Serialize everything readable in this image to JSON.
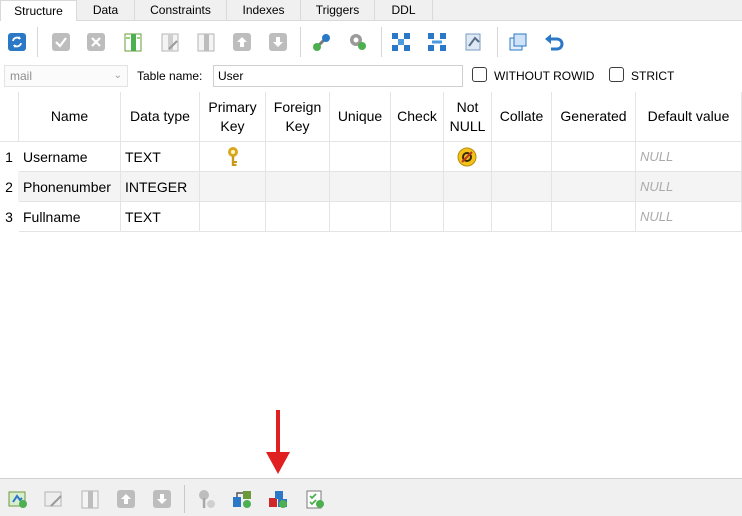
{
  "tabs": [
    {
      "label": "Structure",
      "active": true
    },
    {
      "label": "Data",
      "active": false
    },
    {
      "label": "Constraints",
      "active": false
    },
    {
      "label": "Indexes",
      "active": false
    },
    {
      "label": "Triggers",
      "active": false
    },
    {
      "label": "DDL",
      "active": false
    }
  ],
  "toolbar": {
    "icons": [
      "refresh-icon",
      "commit-icon",
      "rollback-icon",
      "add-column-icon",
      "edit-column-icon",
      "delete-column-icon",
      "move-up-icon",
      "move-down-icon",
      "add-primary-key-icon",
      "add-foreign-key-icon",
      "add-unique-icon",
      "add-check-icon",
      "add-not-null-icon",
      "add-collation-icon",
      "create-similar-table-icon",
      "reset-icon"
    ]
  },
  "table_name_row": {
    "database": "mail",
    "table_name_label": "Table name:",
    "table_name": "User",
    "without_rowid_label": "WITHOUT ROWID",
    "without_rowid_checked": false,
    "strict_label": "STRICT",
    "strict_checked": false
  },
  "grid": {
    "columns": [
      "Name",
      "Data type",
      "Primary\nKey",
      "Foreign\nKey",
      "Unique",
      "Check",
      "Not\nNULL",
      "Collate",
      "Generated",
      "Default value"
    ],
    "rows": [
      {
        "num": "1",
        "name": "Username",
        "type": "TEXT",
        "pk": true,
        "notnull": true,
        "default": "NULL"
      },
      {
        "num": "2",
        "name": "Phonenumber",
        "type": "INTEGER",
        "pk": false,
        "notnull": false,
        "default": "NULL"
      },
      {
        "num": "3",
        "name": "Fullname",
        "type": "TEXT",
        "pk": false,
        "notnull": false,
        "default": "NULL"
      }
    ]
  },
  "bottom_toolbar": {
    "icons": [
      "add-table-constraint-icon",
      "edit-table-constraint-icon",
      "delete-table-constraint-icon",
      "move-constraint-up-icon",
      "move-constraint-down-icon",
      "add-primary-key-constraint-icon",
      "add-foreign-key-constraint-icon",
      "add-unique-constraint-icon",
      "add-check-constraint-icon"
    ]
  },
  "colors": {
    "accent_red": "#e02020",
    "icon_blue": "#2b78c6",
    "icon_gray": "#9a9a9a",
    "key_gold": "#d8a91e"
  }
}
